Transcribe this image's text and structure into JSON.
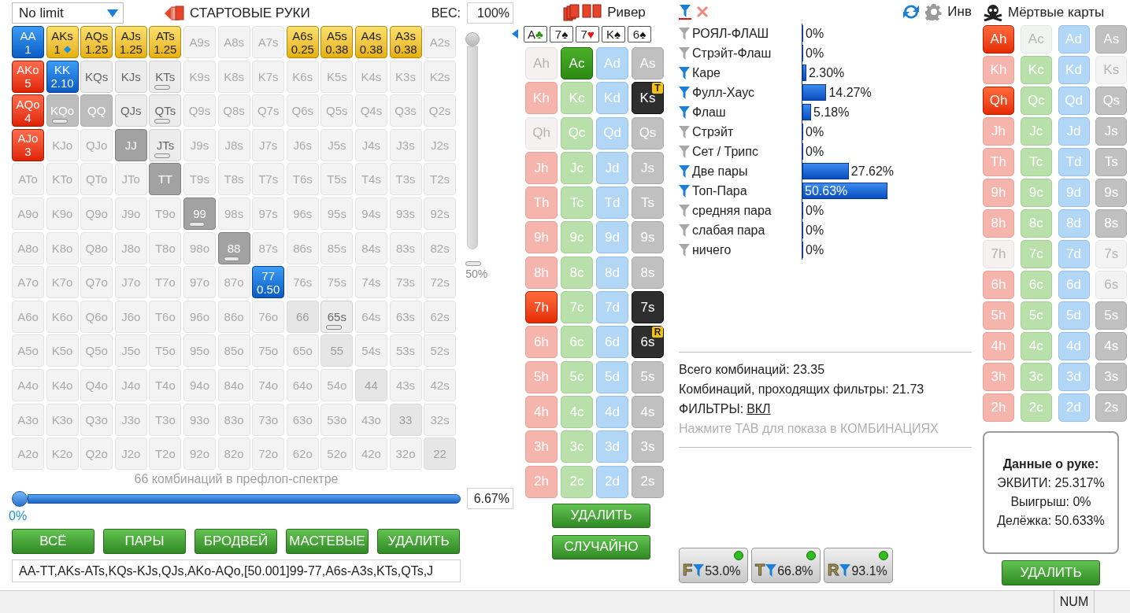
{
  "top": {
    "game": "No limit",
    "title": "СТАРТОВЫЕ РУКИ",
    "weight_label": "ВЕС:",
    "weight_value": "100%"
  },
  "grid": {
    "rows": [
      {
        "cells": [
          {
            "label": "AA",
            "kind": "blue",
            "bar": false,
            "weight": "1"
          },
          {
            "label": "AKs",
            "kind": "yellow",
            "bar": false,
            "weight": "1",
            "badge": "◆"
          },
          {
            "label": "AQs",
            "kind": "yellow",
            "bar": false,
            "weight": "1.25"
          },
          {
            "label": "AJs",
            "kind": "yellow",
            "bar": false,
            "weight": "1.25"
          },
          {
            "label": "ATs",
            "kind": "yellow",
            "bar": false,
            "weight": "1.25"
          },
          {
            "label": "A9s",
            "kind": "off",
            "bar": false
          },
          {
            "label": "A8s",
            "kind": "off",
            "bar": false
          },
          {
            "label": "A7s",
            "kind": "off",
            "bar": false
          },
          {
            "label": "A6s",
            "kind": "yellow",
            "bar": false,
            "weight": "0.25"
          },
          {
            "label": "A5s",
            "kind": "yellow",
            "bar": false,
            "weight": "0.38"
          },
          {
            "label": "A4s",
            "kind": "yellow",
            "bar": false,
            "weight": "0.38"
          },
          {
            "label": "A3s",
            "kind": "yellow",
            "bar": false,
            "weight": "0.38"
          },
          {
            "label": "A2s",
            "kind": "off",
            "bar": false
          }
        ]
      },
      {
        "cells": [
          {
            "label": "AKo",
            "kind": "red",
            "bar": false,
            "weight": "5"
          },
          {
            "label": "KK",
            "kind": "blue",
            "bar": false,
            "weight": "2.10"
          },
          {
            "label": "KQs",
            "kind": "half",
            "bar": false
          },
          {
            "label": "KJs",
            "kind": "half",
            "bar": false
          },
          {
            "label": "KTs",
            "kind": "half",
            "bar": true
          },
          {
            "label": "K9s",
            "kind": "off",
            "bar": false
          },
          {
            "label": "K8s",
            "kind": "off",
            "bar": false
          },
          {
            "label": "K7s",
            "kind": "off",
            "bar": false
          },
          {
            "label": "K6s",
            "kind": "off",
            "bar": false
          },
          {
            "label": "K5s",
            "kind": "off",
            "bar": false
          },
          {
            "label": "K4s",
            "kind": "off",
            "bar": false
          },
          {
            "label": "K3s",
            "kind": "off",
            "bar": false
          },
          {
            "label": "K2s",
            "kind": "off",
            "bar": false
          }
        ]
      },
      {
        "cells": [
          {
            "label": "AQo",
            "kind": "red",
            "bar": false,
            "weight": "4"
          },
          {
            "label": "KQo",
            "kind": "gray",
            "bar": true
          },
          {
            "label": "QQ",
            "kind": "gray",
            "bar": false
          },
          {
            "label": "QJs",
            "kind": "half",
            "bar": false
          },
          {
            "label": "QTs",
            "kind": "half",
            "bar": true
          },
          {
            "label": "Q9s",
            "kind": "off",
            "bar": false
          },
          {
            "label": "Q8s",
            "kind": "off",
            "bar": false
          },
          {
            "label": "Q7s",
            "kind": "off",
            "bar": false
          },
          {
            "label": "Q6s",
            "kind": "off",
            "bar": false
          },
          {
            "label": "Q5s",
            "kind": "off",
            "bar": false
          },
          {
            "label": "Q4s",
            "kind": "off",
            "bar": false
          },
          {
            "label": "Q3s",
            "kind": "off",
            "bar": false
          },
          {
            "label": "Q2s",
            "kind": "off",
            "bar": false
          }
        ]
      },
      {
        "cells": [
          {
            "label": "AJo",
            "kind": "red",
            "bar": false,
            "weight": "3"
          },
          {
            "label": "KJo",
            "kind": "off",
            "bar": false
          },
          {
            "label": "QJo",
            "kind": "off",
            "bar": false
          },
          {
            "label": "JJ",
            "kind": "dark",
            "bar": false
          },
          {
            "label": "JTs",
            "kind": "half",
            "bar": true
          },
          {
            "label": "J9s",
            "kind": "off",
            "bar": false
          },
          {
            "label": "J8s",
            "kind": "off",
            "bar": false
          },
          {
            "label": "J7s",
            "kind": "off",
            "bar": false
          },
          {
            "label": "J6s",
            "kind": "off",
            "bar": false
          },
          {
            "label": "J5s",
            "kind": "off",
            "bar": false
          },
          {
            "label": "J4s",
            "kind": "off",
            "bar": false
          },
          {
            "label": "J3s",
            "kind": "off",
            "bar": false
          },
          {
            "label": "J2s",
            "kind": "off",
            "bar": false
          }
        ]
      },
      {
        "cells": [
          {
            "label": "ATo",
            "kind": "off",
            "bar": false
          },
          {
            "label": "KTo",
            "kind": "off",
            "bar": false
          },
          {
            "label": "QTo",
            "kind": "off",
            "bar": false
          },
          {
            "label": "JTo",
            "kind": "off",
            "bar": false
          },
          {
            "label": "TT",
            "kind": "dark",
            "bar": false
          },
          {
            "label": "T9s",
            "kind": "off",
            "bar": false
          },
          {
            "label": "T8s",
            "kind": "off",
            "bar": false
          },
          {
            "label": "T7s",
            "kind": "off",
            "bar": false
          },
          {
            "label": "T6s",
            "kind": "off",
            "bar": false
          },
          {
            "label": "T5s",
            "kind": "off",
            "bar": false
          },
          {
            "label": "T4s",
            "kind": "off",
            "bar": false
          },
          {
            "label": "T3s",
            "kind": "off",
            "bar": false
          },
          {
            "label": "T2s",
            "kind": "off",
            "bar": false
          }
        ]
      },
      {
        "cells": [
          {
            "label": "A9o",
            "kind": "off",
            "bar": false
          },
          {
            "label": "K9o",
            "kind": "off",
            "bar": false
          },
          {
            "label": "Q9o",
            "kind": "off",
            "bar": false
          },
          {
            "label": "J9o",
            "kind": "off",
            "bar": false
          },
          {
            "label": "T9o",
            "kind": "off",
            "bar": false
          },
          {
            "label": "99",
            "kind": "dark",
            "bar": true
          },
          {
            "label": "98s",
            "kind": "off",
            "bar": false
          },
          {
            "label": "97s",
            "kind": "off",
            "bar": false
          },
          {
            "label": "96s",
            "kind": "off",
            "bar": false
          },
          {
            "label": "95s",
            "kind": "off",
            "bar": false
          },
          {
            "label": "94s",
            "kind": "off",
            "bar": false
          },
          {
            "label": "93s",
            "kind": "off",
            "bar": false
          },
          {
            "label": "92s",
            "kind": "off",
            "bar": false
          }
        ]
      },
      {
        "cells": [
          {
            "label": "A8o",
            "kind": "off",
            "bar": false
          },
          {
            "label": "K8o",
            "kind": "off",
            "bar": false
          },
          {
            "label": "Q8o",
            "kind": "off",
            "bar": false
          },
          {
            "label": "J8o",
            "kind": "off",
            "bar": false
          },
          {
            "label": "T8o",
            "kind": "off",
            "bar": false
          },
          {
            "label": "98o",
            "kind": "off",
            "bar": false
          },
          {
            "label": "88",
            "kind": "dark",
            "bar": true
          },
          {
            "label": "87s",
            "kind": "off",
            "bar": false
          },
          {
            "label": "86s",
            "kind": "off",
            "bar": false
          },
          {
            "label": "85s",
            "kind": "off",
            "bar": false
          },
          {
            "label": "84s",
            "kind": "off",
            "bar": false
          },
          {
            "label": "83s",
            "kind": "off",
            "bar": false
          },
          {
            "label": "82s",
            "kind": "off",
            "bar": false
          }
        ]
      },
      {
        "cells": [
          {
            "label": "A7o",
            "kind": "off",
            "bar": false
          },
          {
            "label": "K7o",
            "kind": "off",
            "bar": false
          },
          {
            "label": "Q7o",
            "kind": "off",
            "bar": false
          },
          {
            "label": "J7o",
            "kind": "off",
            "bar": false
          },
          {
            "label": "T7o",
            "kind": "off",
            "bar": false
          },
          {
            "label": "97o",
            "kind": "off",
            "bar": false
          },
          {
            "label": "87o",
            "kind": "off",
            "bar": false
          },
          {
            "label": "77",
            "kind": "blue",
            "bar": false,
            "weight": "0.50"
          },
          {
            "label": "76s",
            "kind": "off",
            "bar": false
          },
          {
            "label": "75s",
            "kind": "off",
            "bar": false
          },
          {
            "label": "74s",
            "kind": "off",
            "bar": false
          },
          {
            "label": "73s",
            "kind": "off",
            "bar": false
          },
          {
            "label": "72s",
            "kind": "off",
            "bar": false
          }
        ]
      },
      {
        "cells": [
          {
            "label": "A6o",
            "kind": "off",
            "bar": false
          },
          {
            "label": "K6o",
            "kind": "off",
            "bar": false
          },
          {
            "label": "Q6o",
            "kind": "off",
            "bar": false
          },
          {
            "label": "J6o",
            "kind": "off",
            "bar": false
          },
          {
            "label": "T6o",
            "kind": "off",
            "bar": false
          },
          {
            "label": "96o",
            "kind": "off",
            "bar": false
          },
          {
            "label": "86o",
            "kind": "off",
            "bar": false
          },
          {
            "label": "76o",
            "kind": "off",
            "bar": false
          },
          {
            "label": "66",
            "kind": "pair",
            "bar": false
          },
          {
            "label": "65s",
            "kind": "half",
            "bar": true
          },
          {
            "label": "64s",
            "kind": "off",
            "bar": false
          },
          {
            "label": "63s",
            "kind": "off",
            "bar": false
          },
          {
            "label": "62s",
            "kind": "off",
            "bar": false
          }
        ]
      },
      {
        "cells": [
          {
            "label": "A5o",
            "kind": "off",
            "bar": false
          },
          {
            "label": "K5o",
            "kind": "off",
            "bar": false
          },
          {
            "label": "Q5o",
            "kind": "off",
            "bar": false
          },
          {
            "label": "J5o",
            "kind": "off",
            "bar": false
          },
          {
            "label": "T5o",
            "kind": "off",
            "bar": false
          },
          {
            "label": "95o",
            "kind": "off",
            "bar": false
          },
          {
            "label": "85o",
            "kind": "off",
            "bar": false
          },
          {
            "label": "75o",
            "kind": "off",
            "bar": false
          },
          {
            "label": "65o",
            "kind": "off",
            "bar": false
          },
          {
            "label": "55",
            "kind": "pair",
            "bar": false
          },
          {
            "label": "54s",
            "kind": "off",
            "bar": false
          },
          {
            "label": "53s",
            "kind": "off",
            "bar": false
          },
          {
            "label": "52s",
            "kind": "off",
            "bar": false
          }
        ]
      },
      {
        "cells": [
          {
            "label": "A4o",
            "kind": "off",
            "bar": false
          },
          {
            "label": "K4o",
            "kind": "off",
            "bar": false
          },
          {
            "label": "Q4o",
            "kind": "off",
            "bar": false
          },
          {
            "label": "J4o",
            "kind": "off",
            "bar": false
          },
          {
            "label": "T4o",
            "kind": "off",
            "bar": false
          },
          {
            "label": "94o",
            "kind": "off",
            "bar": false
          },
          {
            "label": "84o",
            "kind": "off",
            "bar": false
          },
          {
            "label": "74o",
            "kind": "off",
            "bar": false
          },
          {
            "label": "64o",
            "kind": "off",
            "bar": false
          },
          {
            "label": "54o",
            "kind": "off",
            "bar": false
          },
          {
            "label": "44",
            "kind": "pair",
            "bar": false
          },
          {
            "label": "43s",
            "kind": "off",
            "bar": false
          },
          {
            "label": "42s",
            "kind": "off",
            "bar": false
          }
        ]
      },
      {
        "cells": [
          {
            "label": "A3o",
            "kind": "off",
            "bar": false
          },
          {
            "label": "K3o",
            "kind": "off",
            "bar": false
          },
          {
            "label": "Q3o",
            "kind": "off",
            "bar": false
          },
          {
            "label": "J3o",
            "kind": "off",
            "bar": false
          },
          {
            "label": "T3o",
            "kind": "off",
            "bar": false
          },
          {
            "label": "93o",
            "kind": "off",
            "bar": false
          },
          {
            "label": "83o",
            "kind": "off",
            "bar": false
          },
          {
            "label": "73o",
            "kind": "off",
            "bar": false
          },
          {
            "label": "63o",
            "kind": "off",
            "bar": false
          },
          {
            "label": "53o",
            "kind": "off",
            "bar": false
          },
          {
            "label": "43o",
            "kind": "off",
            "bar": false
          },
          {
            "label": "33",
            "kind": "pair",
            "bar": false
          },
          {
            "label": "32s",
            "kind": "off",
            "bar": false
          }
        ]
      },
      {
        "cells": [
          {
            "label": "A2o",
            "kind": "off",
            "bar": false
          },
          {
            "label": "K2o",
            "kind": "off",
            "bar": false
          },
          {
            "label": "Q2o",
            "kind": "off",
            "bar": false
          },
          {
            "label": "J2o",
            "kind": "off",
            "bar": false
          },
          {
            "label": "T2o",
            "kind": "off",
            "bar": false
          },
          {
            "label": "92o",
            "kind": "off",
            "bar": false
          },
          {
            "label": "82o",
            "kind": "off",
            "bar": false
          },
          {
            "label": "72o",
            "kind": "off",
            "bar": false
          },
          {
            "label": "62o",
            "kind": "off",
            "bar": false
          },
          {
            "label": "52o",
            "kind": "off",
            "bar": false
          },
          {
            "label": "42o",
            "kind": "off",
            "bar": false
          },
          {
            "label": "32o",
            "kind": "off",
            "bar": false
          },
          {
            "label": "22",
            "kind": "pair",
            "bar": false
          }
        ]
      }
    ]
  },
  "weight_slider": {
    "level": 1,
    "label": "50%"
  },
  "range_summary": "66 комбинаций в префлоп-спектре",
  "range_slider": {
    "level": 0,
    "min_label": "0%",
    "value": "6.67%"
  },
  "range_buttons": [
    "ВСЁ",
    "ПАРЫ",
    "БРОДВЕЙ",
    "МАСТЕВЫЕ",
    "УДАЛИТЬ"
  ],
  "range_text": "AA-TT,AKs-ATs,KQs-KJs,QJs,AKo-AQo,[50.001]99-77,A6s-A3s,KTs,QTs,J",
  "board": {
    "street": "Ривер",
    "cards": [
      {
        "rank": "A",
        "symbol": "♣",
        "kind": "club"
      },
      {
        "rank": "7",
        "symbol": "♠",
        "kind": "spade"
      },
      {
        "rank": "7",
        "symbol": "♥",
        "kind": "heart"
      },
      {
        "rank": "K",
        "symbol": "♠",
        "kind": "spade"
      },
      {
        "rank": "6",
        "symbol": "♠",
        "kind": "spade"
      }
    ],
    "deck": [
      [
        {
          "label": "Ah",
          "kind": "heart",
          "selected": false,
          "disabled": true
        },
        {
          "label": "Ac",
          "kind": "club",
          "selected": true,
          "disabled": false
        },
        {
          "label": "Ad",
          "kind": "diamond",
          "selected": false,
          "disabled": false
        },
        {
          "label": "As",
          "kind": "spade",
          "selected": false,
          "disabled": false
        }
      ],
      [
        {
          "label": "Kh",
          "kind": "heart",
          "selected": false,
          "disabled": false
        },
        {
          "label": "Kc",
          "kind": "club",
          "selected": false,
          "disabled": false
        },
        {
          "label": "Kd",
          "kind": "diamond",
          "selected": false,
          "disabled": false
        },
        {
          "label": "Ks",
          "kind": "spade",
          "selected": true,
          "disabled": false,
          "badge": "T"
        }
      ],
      [
        {
          "label": "Qh",
          "kind": "heart",
          "selected": false,
          "disabled": true
        },
        {
          "label": "Qc",
          "kind": "club",
          "selected": false,
          "disabled": false
        },
        {
          "label": "Qd",
          "kind": "diamond",
          "selected": false,
          "disabled": false
        },
        {
          "label": "Qs",
          "kind": "spade",
          "selected": false,
          "disabled": false
        }
      ],
      [
        {
          "label": "Jh",
          "kind": "heart",
          "selected": false,
          "disabled": false
        },
        {
          "label": "Jc",
          "kind": "club",
          "selected": false,
          "disabled": false
        },
        {
          "label": "Jd",
          "kind": "diamond",
          "selected": false,
          "disabled": false
        },
        {
          "label": "Js",
          "kind": "spade",
          "selected": false,
          "disabled": false
        }
      ],
      [
        {
          "label": "Th",
          "kind": "heart",
          "selected": false,
          "disabled": false
        },
        {
          "label": "Tc",
          "kind": "club",
          "selected": false,
          "disabled": false
        },
        {
          "label": "Td",
          "kind": "diamond",
          "selected": false,
          "disabled": false
        },
        {
          "label": "Ts",
          "kind": "spade",
          "selected": false,
          "disabled": false
        }
      ],
      [
        {
          "label": "9h",
          "kind": "heart",
          "selected": false,
          "disabled": false
        },
        {
          "label": "9c",
          "kind": "club",
          "selected": false,
          "disabled": false
        },
        {
          "label": "9d",
          "kind": "diamond",
          "selected": false,
          "disabled": false
        },
        {
          "label": "9s",
          "kind": "spade",
          "selected": false,
          "disabled": false
        }
      ],
      [
        {
          "label": "8h",
          "kind": "heart",
          "selected": false,
          "disabled": false
        },
        {
          "label": "8c",
          "kind": "club",
          "selected": false,
          "disabled": false
        },
        {
          "label": "8d",
          "kind": "diamond",
          "selected": false,
          "disabled": false
        },
        {
          "label": "8s",
          "kind": "spade",
          "selected": false,
          "disabled": false
        }
      ],
      [
        {
          "label": "7h",
          "kind": "heart",
          "selected": true,
          "disabled": false
        },
        {
          "label": "7c",
          "kind": "club",
          "selected": false,
          "disabled": false
        },
        {
          "label": "7d",
          "kind": "diamond",
          "selected": false,
          "disabled": false
        },
        {
          "label": "7s",
          "kind": "spade",
          "selected": true,
          "disabled": false
        }
      ],
      [
        {
          "label": "6h",
          "kind": "heart",
          "selected": false,
          "disabled": false
        },
        {
          "label": "6c",
          "kind": "club",
          "selected": false,
          "disabled": false
        },
        {
          "label": "6d",
          "kind": "diamond",
          "selected": false,
          "disabled": false
        },
        {
          "label": "6s",
          "kind": "spade",
          "selected": true,
          "disabled": false,
          "badge": "R"
        }
      ],
      [
        {
          "label": "5h",
          "kind": "heart",
          "selected": false,
          "disabled": false
        },
        {
          "label": "5c",
          "kind": "club",
          "selected": false,
          "disabled": false
        },
        {
          "label": "5d",
          "kind": "diamond",
          "selected": false,
          "disabled": false
        },
        {
          "label": "5s",
          "kind": "spade",
          "selected": false,
          "disabled": false
        }
      ],
      [
        {
          "label": "4h",
          "kind": "heart",
          "selected": false,
          "disabled": false
        },
        {
          "label": "4c",
          "kind": "club",
          "selected": false,
          "disabled": false
        },
        {
          "label": "4d",
          "kind": "diamond",
          "selected": false,
          "disabled": false
        },
        {
          "label": "4s",
          "kind": "spade",
          "selected": false,
          "disabled": false
        }
      ],
      [
        {
          "label": "3h",
          "kind": "heart",
          "selected": false,
          "disabled": false
        },
        {
          "label": "3c",
          "kind": "club",
          "selected": false,
          "disabled": false
        },
        {
          "label": "3d",
          "kind": "diamond",
          "selected": false,
          "disabled": false
        },
        {
          "label": "3s",
          "kind": "spade",
          "selected": false,
          "disabled": false
        }
      ],
      [
        {
          "label": "2h",
          "kind": "heart",
          "selected": false,
          "disabled": false
        },
        {
          "label": "2c",
          "kind": "club",
          "selected": false,
          "disabled": false
        },
        {
          "label": "2d",
          "kind": "diamond",
          "selected": false,
          "disabled": false
        },
        {
          "label": "2s",
          "kind": "spade",
          "selected": false,
          "disabled": false
        }
      ]
    ],
    "buttons": [
      "УДАЛИТЬ",
      "СЛУЧАЙНО"
    ]
  },
  "filters": {
    "toolbar_label": "Инв",
    "rows": [
      {
        "label": "РОЯЛ-ФЛАШ",
        "active": false,
        "value": "0%",
        "level": 0
      },
      {
        "label": "Стрэйт-Флаш",
        "active": false,
        "value": "0%",
        "level": 0
      },
      {
        "label": "Каре",
        "active": true,
        "value": "2.30%",
        "level": 0.023
      },
      {
        "label": "Фулл-Хаус",
        "active": true,
        "value": "14.27%",
        "level": 0.1427
      },
      {
        "label": "Флаш",
        "active": true,
        "value": "5.18%",
        "level": 0.0518
      },
      {
        "label": "Стрэйт",
        "active": false,
        "value": "0%",
        "level": 0
      },
      {
        "label": "Сет / Трипс",
        "active": false,
        "value": "0%",
        "level": 0
      },
      {
        "label": "Две пары",
        "active": true,
        "value": "27.62%",
        "level": 0.2762
      },
      {
        "label": "Топ-Пара",
        "active": true,
        "value": "50.63%",
        "level": 0.5063
      },
      {
        "label": "средняя пара",
        "active": false,
        "value": "0%",
        "level": 0
      },
      {
        "label": "слабая пара",
        "active": false,
        "value": "0%",
        "level": 0
      },
      {
        "label": "ничего",
        "active": false,
        "value": "0%",
        "level": 0
      }
    ],
    "stats": [
      "Всего комбинаций: 23.35",
      "Комбинаций, проходящих фильтры: 21.73"
    ],
    "filters_label": "ФИЛЬТРЫ:",
    "filters_link": "ВКЛ",
    "hint": "Нажмите TAB для показа в КОМБИНАЦИЯХ",
    "streets": [
      {
        "letter": "F",
        "value": "53.0%",
        "on": true
      },
      {
        "letter": "T",
        "value": "66.8%",
        "on": true
      },
      {
        "letter": "R",
        "value": "93.1%",
        "on": true
      }
    ]
  },
  "dead_cards": {
    "title": "Мёртвые карты",
    "deck": [
      [
        {
          "label": "Ah",
          "kind": "heart",
          "selected": true,
          "disabled": false
        },
        {
          "label": "Ac",
          "kind": "club",
          "selected": false,
          "disabled": true
        },
        {
          "label": "Ad",
          "kind": "diamond",
          "selected": false,
          "disabled": false
        },
        {
          "label": "As",
          "kind": "spade",
          "selected": false,
          "disabled": false
        }
      ],
      [
        {
          "label": "Kh",
          "kind": "heart",
          "selected": false,
          "disabled": false
        },
        {
          "label": "Kc",
          "kind": "club",
          "selected": false,
          "disabled": false
        },
        {
          "label": "Kd",
          "kind": "diamond",
          "selected": false,
          "disabled": false
        },
        {
          "label": "Ks",
          "kind": "spade",
          "selected": false,
          "disabled": true
        }
      ],
      [
        {
          "label": "Qh",
          "kind": "heart",
          "selected": true,
          "disabled": false
        },
        {
          "label": "Qc",
          "kind": "club",
          "selected": false,
          "disabled": false
        },
        {
          "label": "Qd",
          "kind": "diamond",
          "selected": false,
          "disabled": false
        },
        {
          "label": "Qs",
          "kind": "spade",
          "selected": false,
          "disabled": false
        }
      ],
      [
        {
          "label": "Jh",
          "kind": "heart",
          "selected": false,
          "disabled": false
        },
        {
          "label": "Jc",
          "kind": "club",
          "selected": false,
          "disabled": false
        },
        {
          "label": "Jd",
          "kind": "diamond",
          "selected": false,
          "disabled": false
        },
        {
          "label": "Js",
          "kind": "spade",
          "selected": false,
          "disabled": false
        }
      ],
      [
        {
          "label": "Th",
          "kind": "heart",
          "selected": false,
          "disabled": false
        },
        {
          "label": "Tc",
          "kind": "club",
          "selected": false,
          "disabled": false
        },
        {
          "label": "Td",
          "kind": "diamond",
          "selected": false,
          "disabled": false
        },
        {
          "label": "Ts",
          "kind": "spade",
          "selected": false,
          "disabled": false
        }
      ],
      [
        {
          "label": "9h",
          "kind": "heart",
          "selected": false,
          "disabled": false
        },
        {
          "label": "9c",
          "kind": "club",
          "selected": false,
          "disabled": false
        },
        {
          "label": "9d",
          "kind": "diamond",
          "selected": false,
          "disabled": false
        },
        {
          "label": "9s",
          "kind": "spade",
          "selected": false,
          "disabled": false
        }
      ],
      [
        {
          "label": "8h",
          "kind": "heart",
          "selected": false,
          "disabled": false
        },
        {
          "label": "8c",
          "kind": "club",
          "selected": false,
          "disabled": false
        },
        {
          "label": "8d",
          "kind": "diamond",
          "selected": false,
          "disabled": false
        },
        {
          "label": "8s",
          "kind": "spade",
          "selected": false,
          "disabled": false
        }
      ],
      [
        {
          "label": "7h",
          "kind": "heart",
          "selected": false,
          "disabled": true
        },
        {
          "label": "7c",
          "kind": "club",
          "selected": false,
          "disabled": false
        },
        {
          "label": "7d",
          "kind": "diamond",
          "selected": false,
          "disabled": false
        },
        {
          "label": "7s",
          "kind": "spade",
          "selected": false,
          "disabled": true
        }
      ],
      [
        {
          "label": "6h",
          "kind": "heart",
          "selected": false,
          "disabled": false
        },
        {
          "label": "6c",
          "kind": "club",
          "selected": false,
          "disabled": false
        },
        {
          "label": "6d",
          "kind": "diamond",
          "selected": false,
          "disabled": false
        },
        {
          "label": "6s",
          "kind": "spade",
          "selected": false,
          "disabled": true
        }
      ],
      [
        {
          "label": "5h",
          "kind": "heart",
          "selected": false,
          "disabled": false
        },
        {
          "label": "5c",
          "kind": "club",
          "selected": false,
          "disabled": false
        },
        {
          "label": "5d",
          "kind": "diamond",
          "selected": false,
          "disabled": false
        },
        {
          "label": "5s",
          "kind": "spade",
          "selected": false,
          "disabled": false
        }
      ],
      [
        {
          "label": "4h",
          "kind": "heart",
          "selected": false,
          "disabled": false
        },
        {
          "label": "4c",
          "kind": "club",
          "selected": false,
          "disabled": false
        },
        {
          "label": "4d",
          "kind": "diamond",
          "selected": false,
          "disabled": false
        },
        {
          "label": "4s",
          "kind": "spade",
          "selected": false,
          "disabled": false
        }
      ],
      [
        {
          "label": "3h",
          "kind": "heart",
          "selected": false,
          "disabled": false
        },
        {
          "label": "3c",
          "kind": "club",
          "selected": false,
          "disabled": false
        },
        {
          "label": "3d",
          "kind": "diamond",
          "selected": false,
          "disabled": false
        },
        {
          "label": "3s",
          "kind": "spade",
          "selected": false,
          "disabled": false
        }
      ],
      [
        {
          "label": "2h",
          "kind": "heart",
          "selected": false,
          "disabled": false
        },
        {
          "label": "2c",
          "kind": "club",
          "selected": false,
          "disabled": false
        },
        {
          "label": "2d",
          "kind": "diamond",
          "selected": false,
          "disabled": false
        },
        {
          "label": "2s",
          "kind": "spade",
          "selected": false,
          "disabled": false
        }
      ]
    ],
    "hand": {
      "title": "Данные о руке:",
      "lines": [
        "ЭКВИТИ: 25.317%",
        "Выигрыш: 0%",
        "Делёжка: 50.633%"
      ]
    },
    "button": "УДАЛИТЬ"
  },
  "status_bar": {
    "indicator": "NUM"
  }
}
